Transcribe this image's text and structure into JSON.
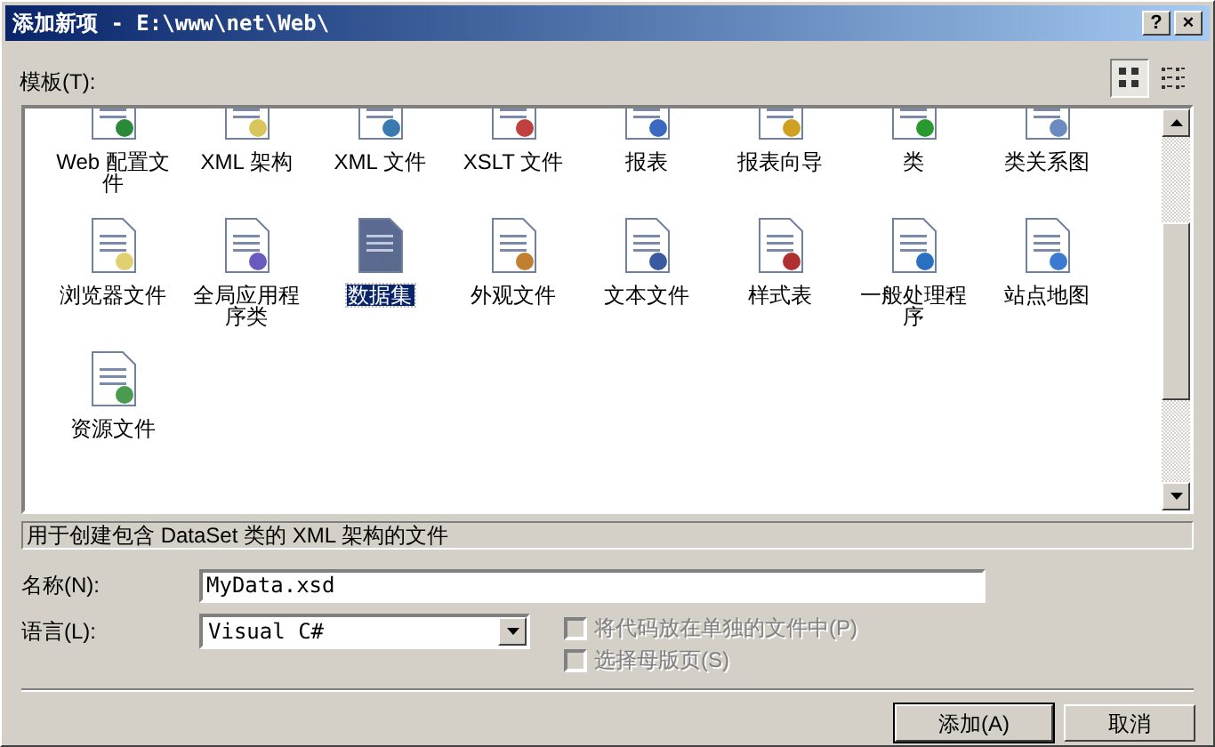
{
  "window": {
    "title": "添加新项 - E:\\www\\net\\Web\\"
  },
  "title_buttons": [
    "?",
    "×"
  ],
  "templates_label": "模板(T):",
  "view_toggle": [
    {
      "selected": true
    },
    {
      "selected": false
    }
  ],
  "templates": [
    {
      "label": "Web 配置文件",
      "selected": false
    },
    {
      "label": "XML 架构",
      "selected": false
    },
    {
      "label": "XML 文件",
      "selected": false
    },
    {
      "label": "XSLT 文件",
      "selected": false
    },
    {
      "label": "报表",
      "selected": false
    },
    {
      "label": "报表向导",
      "selected": false
    },
    {
      "label": "类",
      "selected": false
    },
    {
      "label": "类关系图",
      "selected": false
    },
    {
      "label": "浏览器文件",
      "selected": false
    },
    {
      "label": "全局应用程序类",
      "selected": false
    },
    {
      "label": "数据集",
      "selected": true
    },
    {
      "label": "外观文件",
      "selected": false
    },
    {
      "label": "文本文件",
      "selected": false
    },
    {
      "label": "样式表",
      "selected": false
    },
    {
      "label": "一般处理程序",
      "selected": false
    },
    {
      "label": "站点地图",
      "selected": false
    },
    {
      "label": "资源文件",
      "selected": false
    }
  ],
  "description": "用于创建包含 DataSet 类的 XML 架构的文件",
  "name_field": {
    "label": "名称(N):",
    "value": "MyData.xsd"
  },
  "language_field": {
    "label": "语言(L):",
    "value": "Visual C#"
  },
  "options": [
    {
      "label": "将代码放在单独的文件中(P)",
      "checked": false,
      "disabled": true
    },
    {
      "label": "选择母版页(S)",
      "checked": false,
      "disabled": true
    }
  ],
  "buttons": [
    {
      "label": "添加(A)",
      "default": true
    },
    {
      "label": "取消",
      "default": false
    }
  ]
}
